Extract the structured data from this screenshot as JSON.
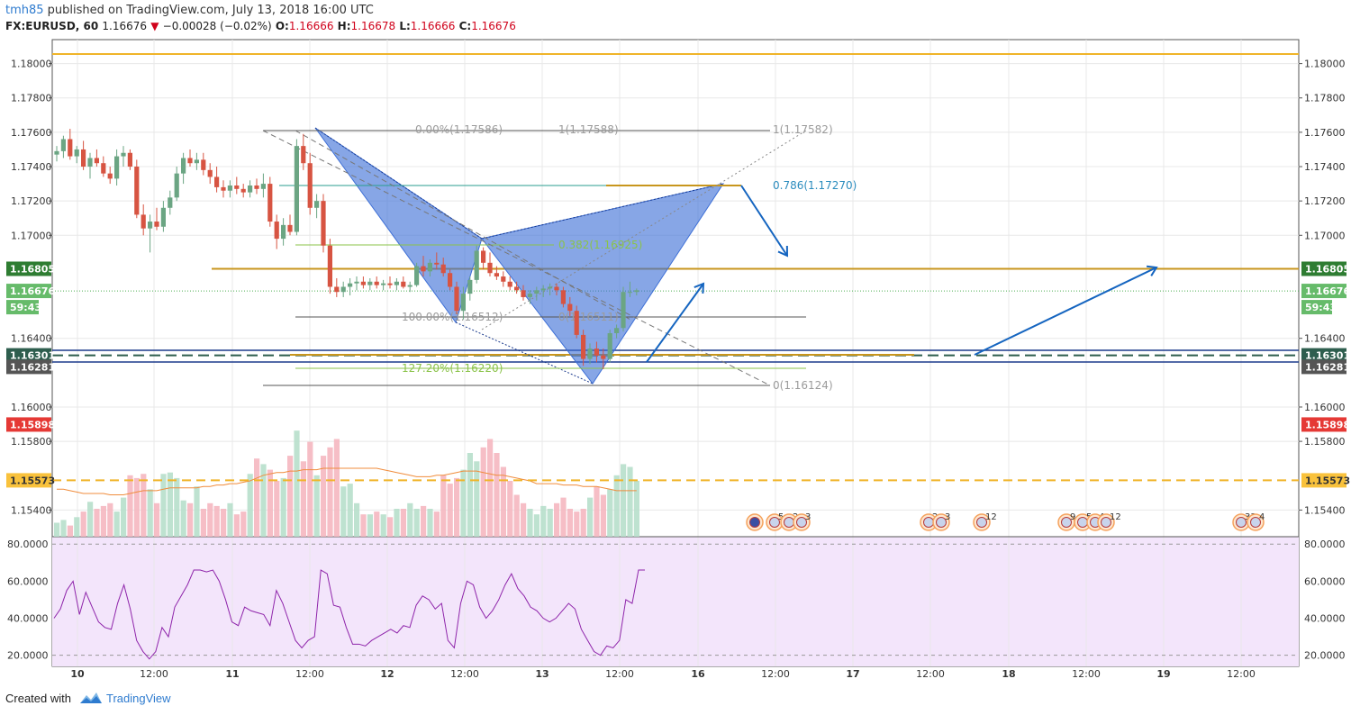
{
  "header": {
    "user": "tmh85",
    "published_text": " published on TradingView.com, July 13, 2018 16:00 UTC",
    "symbol": "FX:EURUSD, 60",
    "last": "1.16676",
    "change": "−0.00028 (−0.02%)",
    "open_label": "O:",
    "open": "1.16666",
    "high_label": "H:",
    "high": "1.16678",
    "low_label": "L:",
    "low": "1.16666",
    "close_label": "C:",
    "close": "1.16676"
  },
  "footer": {
    "created": "Created with",
    "brand": "TradingView"
  },
  "colors": {
    "up": "#6ba583",
    "down": "#d75442",
    "harmonic": "#3d6fd6",
    "fib_gray": "#9b9b9b",
    "fib_green": "#8bc34a",
    "orange_line": "#f0b429",
    "gold_line": "#c8961d",
    "rsi_bg": "#f3e5fb",
    "rsi_line": "#8e24aa",
    "navy": "#1b3a8c",
    "arrow": "#1565c0"
  },
  "chart_data": [
    {
      "type": "candlestick",
      "symbol": "FX:EURUSD",
      "timeframe": "60",
      "ylim": [
        1.1525,
        1.1815
      ],
      "y_ticks": [
        "1.18000",
        "1.17800",
        "1.17600",
        "1.17400",
        "1.17200",
        "1.17000",
        "1.16400",
        "1.16000",
        "1.15800",
        "1.15400"
      ],
      "x_ticks": [
        "10",
        "12:00",
        "11",
        "12:00",
        "12",
        "12:00",
        "13",
        "12:00",
        "16",
        "12:00",
        "17",
        "12:00",
        "18",
        "12:00",
        "19",
        "12:00"
      ],
      "series": [
        {
          "name": "EURUSD",
          "ohlc": [
            [
              1.1747,
              1.1752,
              1.1743,
              1.1749
            ],
            [
              1.1749,
              1.1758,
              1.1745,
              1.1756
            ],
            [
              1.1756,
              1.1762,
              1.1744,
              1.1746
            ],
            [
              1.1746,
              1.1752,
              1.1742,
              1.175
            ],
            [
              1.175,
              1.1755,
              1.1738,
              1.174
            ],
            [
              1.174,
              1.1748,
              1.1733,
              1.1745
            ],
            [
              1.1745,
              1.175,
              1.174,
              1.1742
            ],
            [
              1.1742,
              1.1746,
              1.1734,
              1.1736
            ],
            [
              1.1736,
              1.174,
              1.173,
              1.1733
            ],
            [
              1.1733,
              1.175,
              1.1729,
              1.1746
            ],
            [
              1.1746,
              1.1752,
              1.174,
              1.1748
            ],
            [
              1.1748,
              1.175,
              1.1738,
              1.174
            ],
            [
              1.174,
              1.1744,
              1.171,
              1.1712
            ],
            [
              1.1712,
              1.1718,
              1.17,
              1.1704
            ],
            [
              1.1704,
              1.1712,
              1.169,
              1.1708
            ],
            [
              1.1708,
              1.1716,
              1.1703,
              1.1705
            ],
            [
              1.1705,
              1.172,
              1.1702,
              1.1716
            ],
            [
              1.1716,
              1.1726,
              1.1712,
              1.1722
            ],
            [
              1.1722,
              1.174,
              1.172,
              1.1736
            ],
            [
              1.1736,
              1.1748,
              1.173,
              1.1745
            ],
            [
              1.1745,
              1.175,
              1.174,
              1.1742
            ],
            [
              1.1742,
              1.1748,
              1.1738,
              1.1744
            ],
            [
              1.1744,
              1.1748,
              1.1735,
              1.1738
            ],
            [
              1.1738,
              1.1742,
              1.173,
              1.1734
            ],
            [
              1.1734,
              1.174,
              1.1725,
              1.1728
            ],
            [
              1.1728,
              1.1732,
              1.1722,
              1.1726
            ],
            [
              1.1726,
              1.1732,
              1.1722,
              1.1729
            ],
            [
              1.1729,
              1.1734,
              1.1724,
              1.1727
            ],
            [
              1.1727,
              1.173,
              1.1722,
              1.1725
            ],
            [
              1.1725,
              1.1732,
              1.1722,
              1.1729
            ],
            [
              1.1729,
              1.1733,
              1.1724,
              1.1727
            ],
            [
              1.1727,
              1.1736,
              1.1722,
              1.173
            ],
            [
              1.173,
              1.1734,
              1.1705,
              1.1708
            ],
            [
              1.1708,
              1.1712,
              1.1692,
              1.1698
            ],
            [
              1.1698,
              1.171,
              1.1694,
              1.1706
            ],
            [
              1.1706,
              1.1712,
              1.17,
              1.1702
            ],
            [
              1.1702,
              1.1756,
              1.17,
              1.1752
            ],
            [
              1.1752,
              1.1759,
              1.1738,
              1.1742
            ],
            [
              1.1742,
              1.1748,
              1.1712,
              1.1716
            ],
            [
              1.1716,
              1.1724,
              1.171,
              1.172
            ],
            [
              1.172,
              1.1724,
              1.169,
              1.1694
            ],
            [
              1.1694,
              1.1698,
              1.1666,
              1.167
            ],
            [
              1.167,
              1.1675,
              1.1664,
              1.1667
            ],
            [
              1.1667,
              1.1673,
              1.1664,
              1.167
            ],
            [
              1.167,
              1.1675,
              1.1665,
              1.1672
            ],
            [
              1.1672,
              1.1676,
              1.1668,
              1.1673
            ],
            [
              1.1673,
              1.1676,
              1.1669,
              1.1671
            ],
            [
              1.1671,
              1.1675,
              1.1668,
              1.1673
            ],
            [
              1.1673,
              1.1676,
              1.1669,
              1.1671
            ],
            [
              1.1671,
              1.1674,
              1.1668,
              1.1672
            ],
            [
              1.1672,
              1.1676,
              1.1669,
              1.1671
            ],
            [
              1.1671,
              1.1675,
              1.1668,
              1.1673
            ],
            [
              1.1673,
              1.1676,
              1.1669,
              1.167
            ],
            [
              1.167,
              1.1673,
              1.1667,
              1.1671
            ],
            [
              1.1671,
              1.1684,
              1.167,
              1.1682
            ],
            [
              1.1682,
              1.1688,
              1.1676,
              1.1679
            ],
            [
              1.1679,
              1.1686,
              1.1676,
              1.1684
            ],
            [
              1.1684,
              1.169,
              1.168,
              1.1683
            ],
            [
              1.1683,
              1.1687,
              1.1676,
              1.1678
            ],
            [
              1.1678,
              1.168,
              1.1668,
              1.167
            ],
            [
              1.167,
              1.1673,
              1.1654,
              1.1656
            ],
            [
              1.1656,
              1.167,
              1.1651,
              1.1666
            ],
            [
              1.1666,
              1.1676,
              1.1662,
              1.1674
            ],
            [
              1.1674,
              1.1694,
              1.1672,
              1.1691
            ],
            [
              1.1691,
              1.1693,
              1.168,
              1.1684
            ],
            [
              1.1684,
              1.169,
              1.1676,
              1.1678
            ],
            [
              1.1678,
              1.1682,
              1.1674,
              1.1676
            ],
            [
              1.1676,
              1.1679,
              1.167,
              1.1673
            ],
            [
              1.1673,
              1.1676,
              1.1668,
              1.167
            ],
            [
              1.167,
              1.1673,
              1.1666,
              1.1668
            ],
            [
              1.1668,
              1.1671,
              1.1662,
              1.1664
            ],
            [
              1.1664,
              1.1668,
              1.166,
              1.1666
            ],
            [
              1.1666,
              1.167,
              1.1662,
              1.1668
            ],
            [
              1.1668,
              1.1671,
              1.1664,
              1.1669
            ],
            [
              1.1669,
              1.1672,
              1.1665,
              1.167
            ],
            [
              1.167,
              1.1672,
              1.1665,
              1.1668
            ],
            [
              1.1668,
              1.167,
              1.1658,
              1.166
            ],
            [
              1.166,
              1.1664,
              1.1653,
              1.1656
            ],
            [
              1.1656,
              1.1659,
              1.164,
              1.1642
            ],
            [
              1.1642,
              1.1645,
              1.1624,
              1.1628
            ],
            [
              1.1628,
              1.1637,
              1.1625,
              1.1634
            ],
            [
              1.1634,
              1.1638,
              1.1626,
              1.163
            ],
            [
              1.163,
              1.1634,
              1.1622,
              1.1628
            ],
            [
              1.1628,
              1.1645,
              1.1626,
              1.1643
            ],
            [
              1.1643,
              1.1648,
              1.164,
              1.1646
            ],
            [
              1.1646,
              1.167,
              1.1644,
              1.1667
            ],
            [
              1.1667,
              1.1673,
              1.1664,
              1.1667
            ],
            [
              1.1667,
              1.1669,
              1.1665,
              1.1668
            ]
          ]
        }
      ],
      "volume": {
        "values": [
          10,
          12,
          8,
          14,
          18,
          25,
          20,
          22,
          24,
          18,
          28,
          44,
          42,
          45,
          34,
          24,
          45,
          46,
          42,
          26,
          24,
          36,
          20,
          24,
          22,
          20,
          24,
          16,
          18,
          45,
          56,
          52,
          48,
          40,
          42,
          58,
          76,
          54,
          68,
          44,
          58,
          64,
          70,
          36,
          38,
          24,
          16,
          16,
          18,
          16,
          14,
          20,
          20,
          24,
          20,
          22,
          20,
          18,
          44,
          38,
          42,
          48,
          60,
          54,
          64,
          70,
          60,
          50,
          40,
          30,
          24,
          20,
          16,
          22,
          20,
          24,
          28,
          20,
          18,
          20,
          28,
          36,
          30,
          34,
          44,
          52,
          50,
          40
        ]
      },
      "volume_ma": [
        34,
        34,
        33,
        32,
        31,
        31,
        31,
        31,
        30,
        30,
        30,
        31,
        32,
        33,
        33,
        33,
        34,
        35,
        35,
        35,
        35,
        35,
        36,
        36,
        37,
        37,
        38,
        38,
        39,
        40,
        42,
        44,
        45,
        46,
        46,
        47,
        47,
        48,
        48,
        48,
        49,
        49,
        49,
        49,
        49,
        49,
        49,
        49,
        49,
        48,
        47,
        46,
        45,
        44,
        43,
        43,
        43,
        44,
        44,
        45,
        46,
        47,
        47,
        47,
        46,
        45,
        44,
        44,
        43,
        42,
        41,
        40,
        38,
        38,
        38,
        38,
        37,
        37,
        37,
        36,
        36,
        36,
        35,
        34,
        33,
        33,
        33,
        33
      ],
      "rsi": {
        "name": "RSI",
        "y_ticks": [
          "80.0000",
          "60.0000",
          "40.0000",
          "20.0000"
        ],
        "ylim": [
          14,
          84
        ],
        "values": [
          40,
          45,
          55,
          60,
          42,
          54,
          46,
          38,
          35,
          34,
          48,
          58,
          45,
          28,
          22,
          18,
          22,
          35,
          30,
          46,
          52,
          58,
          66,
          66,
          65,
          66,
          60,
          50,
          38,
          36,
          46,
          44,
          43,
          42,
          36,
          55,
          48,
          38,
          28,
          24,
          28,
          30,
          66,
          64,
          47,
          46,
          35,
          26,
          26,
          25,
          28,
          30,
          32,
          34,
          32,
          36,
          35,
          47,
          52,
          50,
          45,
          48,
          28,
          24,
          48,
          60,
          58,
          46,
          40,
          44,
          50,
          58,
          64,
          56,
          52,
          46,
          44,
          40,
          38,
          40,
          44,
          48,
          45,
          34,
          28,
          22,
          20,
          25,
          24,
          28,
          50,
          48,
          66,
          66
        ]
      },
      "levels": [
        {
          "label": "1.16805",
          "value": 1.16805
        },
        {
          "label": "1.16676",
          "value": 1.16676
        },
        {
          "label": "59:43",
          "value": 1.16676
        },
        {
          "label": "1.16301",
          "value": 1.16301
        },
        {
          "label": "1.16281",
          "value": 1.16281
        },
        {
          "label": "1.15898",
          "value": 1.15898
        },
        {
          "label": "1.15573",
          "value": 1.15573
        }
      ],
      "annotations": [
        {
          "text": "0.00%(1.17586)"
        },
        {
          "text": "1(1.17588)"
        },
        {
          "text": "1(1.17582)"
        },
        {
          "text": "0.786(1.17270)"
        },
        {
          "text": "0.382(1.16925)"
        },
        {
          "text": "100.00%(1.16512)"
        },
        {
          "text": "0(1.16511)"
        },
        {
          "text": "127.20%(1.16220)"
        },
        {
          "text": "0(1.16124)"
        }
      ],
      "events": [
        {
          "count": ""
        },
        {
          "count": "5"
        },
        {
          "count": "2"
        },
        {
          "count": "3"
        },
        {
          "count": "2"
        },
        {
          "count": "3"
        },
        {
          "count": "12"
        },
        {
          "count": "9"
        },
        {
          "count": "5"
        },
        {
          "count": "4"
        },
        {
          "count": "12"
        },
        {
          "count": "33"
        },
        {
          "count": "4"
        }
      ]
    }
  ]
}
